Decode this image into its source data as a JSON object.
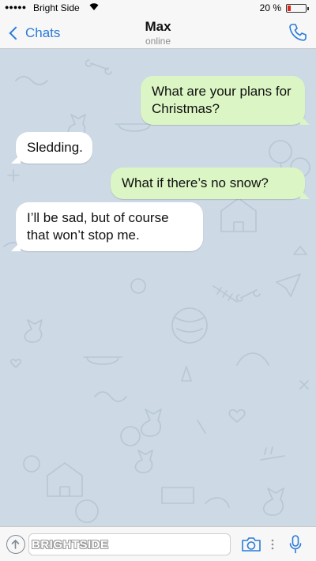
{
  "status_bar": {
    "signal": "●●●●●",
    "carrier": "Bright Side",
    "wifi_icon": "wifi-icon",
    "battery_text": "20 %",
    "battery_level": 0.2,
    "battery_color": "#e0261a"
  },
  "header": {
    "back_label": "Chats",
    "contact_name": "Max",
    "contact_status": "online",
    "call_icon": "phone-icon"
  },
  "messages": [
    {
      "direction": "outgoing",
      "text": "What are your plans for Christmas?"
    },
    {
      "direction": "incoming",
      "text": "Sledding."
    },
    {
      "direction": "outgoing",
      "text": "What if there’s no snow?"
    },
    {
      "direction": "incoming",
      "text": "I’ll be sad, but of course that won’t stop me."
    }
  ],
  "input_bar": {
    "watermark": "BRIGHTSIDE",
    "placeholder": "",
    "attach_icon": "attach-icon",
    "camera_icon": "camera-icon",
    "mic_icon": "microphone-icon"
  },
  "colors": {
    "accent": "#2a7bd8",
    "outgoing_bubble": "#dbf5c4",
    "incoming_bubble": "#ffffff",
    "chat_background": "#cdd9e4"
  }
}
